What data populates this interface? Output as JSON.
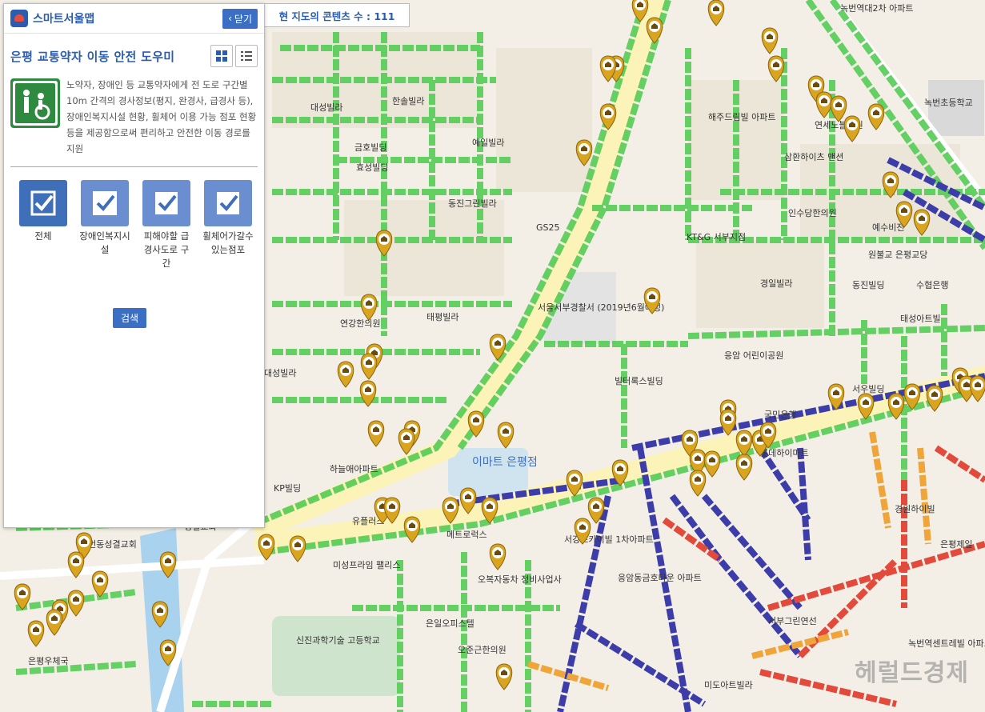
{
  "panel": {
    "brand": "스마트서울맵",
    "close_label": "닫기",
    "title": "은평 교통약자 이동 안전 도우미",
    "description": "노약자, 장애인 등 교통약자에게 전 도로 구간별 10m 간격의 경사정보(평지, 완경사, 급경사 등), 장애인복지시설 현황, 휠체어 이용 가능 점포 현황 등을 제공함으로써 편리하고 안전한 이동 경로를 지원",
    "categories": [
      {
        "label": "전체",
        "icon": "check-icon"
      },
      {
        "label": "장애인복지시설",
        "icon": "check-pin-icon"
      },
      {
        "label": "피해야할 급경사도로 구간",
        "icon": "check-pin-icon"
      },
      {
        "label": "휠체어가갈수있는점포",
        "icon": "check-pin-icon"
      }
    ],
    "search_label": "검색"
  },
  "map": {
    "counter": "현 지도의 콘텐츠 수 : 111",
    "watermark": "헤럴드경제",
    "labels": [
      "녹번역대2차 아파트",
      "녹번초등학교",
      "해주드림빌 아파트",
      "연세노블병원",
      "삼환하이츠 맨션",
      "인수당한의원",
      "예수비전",
      "원불교 은평교당",
      "KT&G 서부지점",
      "경일빌라",
      "동진빌딩",
      "수협은행",
      "태성아트빌",
      "서울서부경찰서 (2019년6월예정)",
      "응암 어린이공원",
      "빌터록스빌딩",
      "국민은행",
      "롯데하이마트",
      "서우빌딩",
      "경원하이빌",
      "은평제일",
      "이마트 은평점",
      "KP빌딩",
      "하늘애아파트",
      "태평빌라",
      "연강한의원",
      "대성빌라",
      "한솔빌라",
      "금호빌딩",
      "효성빌딩",
      "예일빌라",
      "동진그린빌라",
      "GS25",
      "유플러스",
      "미성프라임 팰리스",
      "메트로럭스",
      "오복자동차 정비사업사",
      "서강스카이빌 1차아파트",
      "응암동금호타운 아파트",
      "서부그린연선",
      "녹번역센트레빌 아파트",
      "신진과학기술 고등학교",
      "은평우체국",
      "은일오피스텔",
      "오준근한의원",
      "미도아트빌라",
      "성결교회",
      "녹번동성결교회",
      "대성빌라"
    ]
  },
  "colors": {
    "accent": "#2a5db0",
    "road": "#ffffff",
    "major_road": "#fbf3b8",
    "flat": "#55cc55",
    "mild": "#3d3daa",
    "steep": "#e24a3c",
    "moderate": "#f0a53a",
    "pin": "#d9a520"
  }
}
